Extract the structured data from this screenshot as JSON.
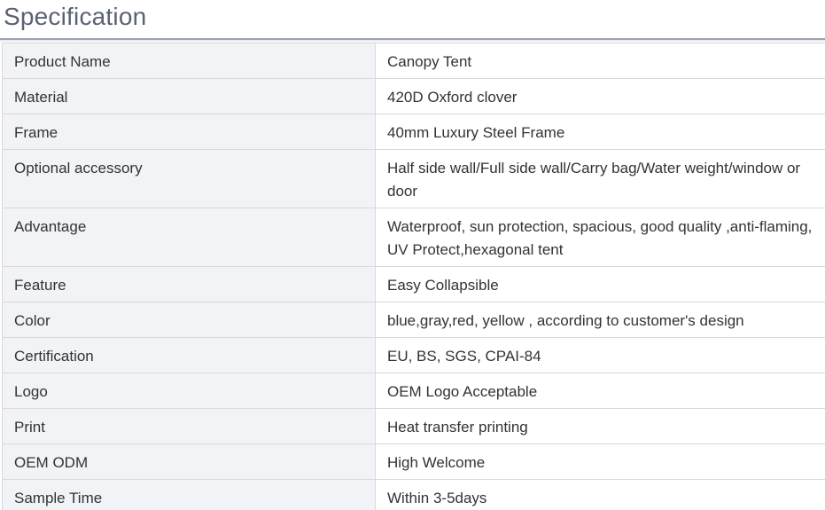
{
  "section": {
    "title": "Specification"
  },
  "spec_table": {
    "rows": [
      {
        "label": "Product Name",
        "value": "Canopy Tent"
      },
      {
        "label": "Material",
        "value": "420D Oxford clover"
      },
      {
        "label": "Frame",
        "value": "40mm Luxury Steel Frame"
      },
      {
        "label": "Optional accessory",
        "value": "Half side wall/Full side wall/Carry bag/Water weight/window or door"
      },
      {
        "label": "Advantage",
        "value": "Waterproof, sun protection, spacious, good quality ,anti-flaming, UV Protect,hexagonal tent"
      },
      {
        "label": "Feature",
        "value": "Easy Collapsible"
      },
      {
        "label": "Color",
        "value": "blue,gray,red, yellow , according to customer's design"
      },
      {
        "label": "Certification",
        "value": "EU, BS, SGS, CPAI-84"
      },
      {
        "label": "Logo",
        "value": "OEM Logo Acceptable"
      },
      {
        "label": "Print",
        "value": "Heat transfer printing"
      },
      {
        "label": "OEM ODM",
        "value": "High Welcome"
      },
      {
        "label": "Sample Time",
        "value": "Within 3-5days"
      }
    ]
  },
  "colors": {
    "title_text": "#5a6272",
    "label_cell_bg": "#f2f3f6",
    "border": "#d9d9d9",
    "body_text": "#333333"
  }
}
